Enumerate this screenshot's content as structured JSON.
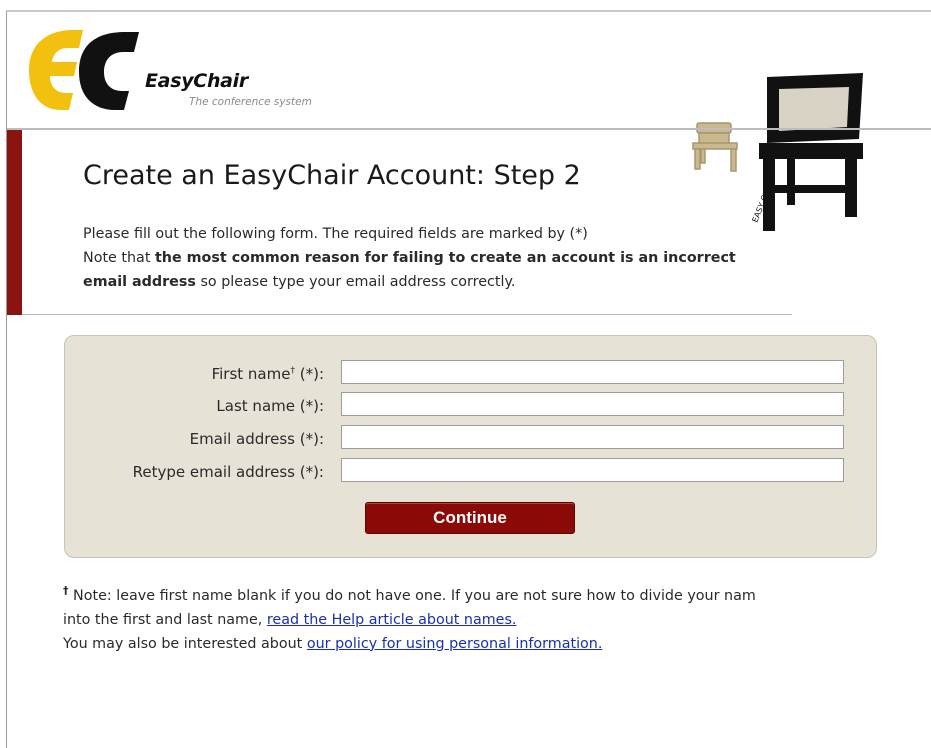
{
  "header": {
    "brand_name": "EasyChair",
    "tagline": "The conference system",
    "chair_caption": "EASY CHAIR"
  },
  "page": {
    "title": "Create an EasyChair Account: Step 2",
    "intro_line1": "Please fill out the following form. The required fields are marked by (*)",
    "intro_note_prefix": "Note that ",
    "intro_note_bold": "the most common reason for failing to create an account is an incorrect email address",
    "intro_note_suffix": " so please type your email address correctly."
  },
  "form": {
    "fields": [
      {
        "label": "First name",
        "mark": "†",
        "required": " (*):",
        "value": ""
      },
      {
        "label": "Last name (*):",
        "value": ""
      },
      {
        "label": "Email address (*):",
        "value": ""
      },
      {
        "label": "Retype email address (*):",
        "value": ""
      }
    ],
    "continue_label": "Continue"
  },
  "footer": {
    "dagger": "†",
    "note_text": " Note: leave first name blank if you do not have one. If you are not sure how to divide your nam",
    "note_line2_prefix": "into the first and last name, ",
    "help_link": "read the Help article about names.",
    "policy_prefix": "You may also be interested about ",
    "policy_link": "our policy for using personal information."
  },
  "colors": {
    "accent_red": "#8b1410",
    "button_red": "#8b0a08",
    "form_bg": "#e6e2d6",
    "logo_yellow": "#f2c00f",
    "link_blue": "#1a2fb0"
  }
}
